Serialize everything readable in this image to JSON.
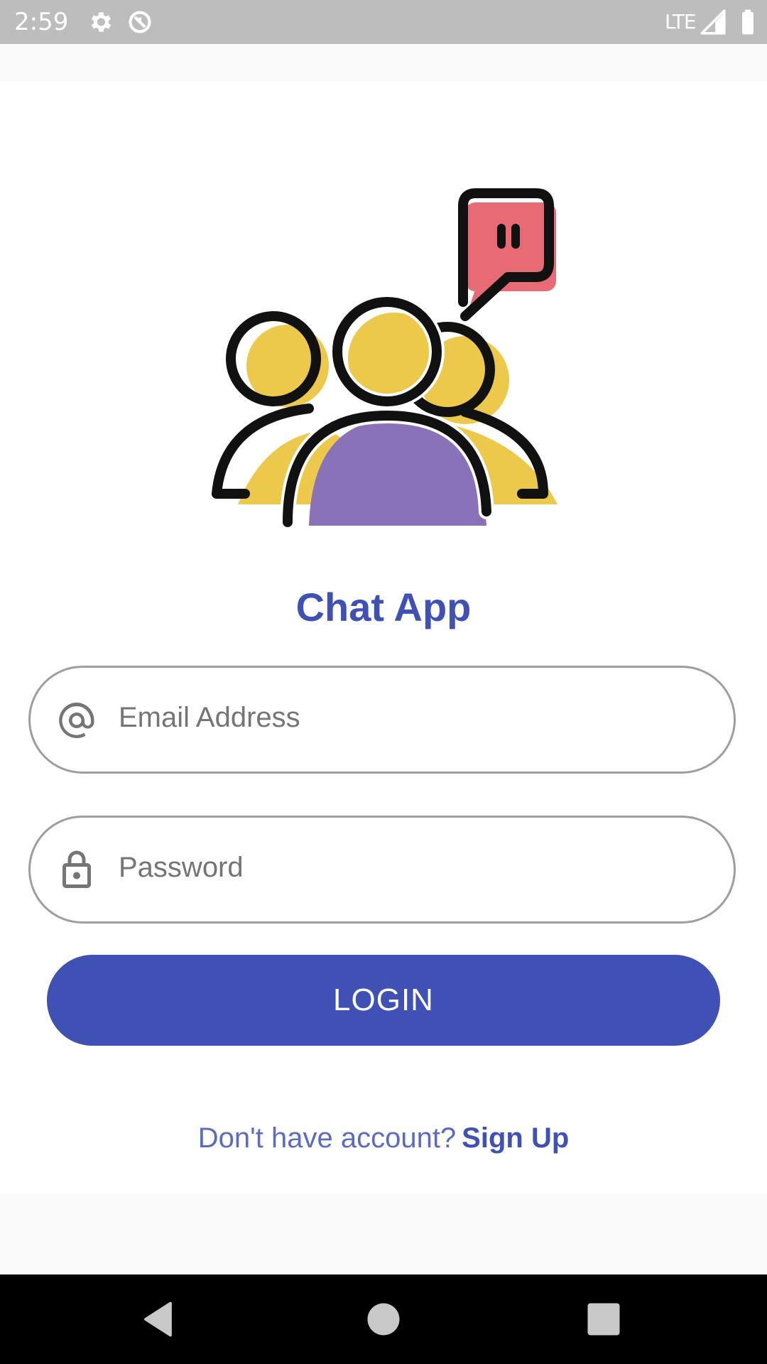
{
  "status_bar": {
    "time": "2:59",
    "network": "LTE",
    "icons": [
      "settings-icon",
      "sync-icon",
      "signal-icon",
      "battery-icon"
    ]
  },
  "app": {
    "title": "Chat App",
    "logo": "group-chat-logo"
  },
  "form": {
    "email": {
      "placeholder": "Email Address",
      "value": "",
      "icon": "at-sign-icon"
    },
    "password": {
      "placeholder": "Password",
      "value": "",
      "icon": "lock-icon"
    },
    "login_label": "LOGIN"
  },
  "footer": {
    "prompt": "Don't have account?",
    "signup_label": "Sign Up"
  },
  "nav_bar": {
    "buttons": [
      "back-icon",
      "home-icon",
      "recents-icon"
    ]
  },
  "colors": {
    "primary": "#3f51b5",
    "status_bar": "#bdbdbd",
    "nav_bar": "#000000",
    "logo_yellow": "#ecc94b",
    "logo_purple": "#8a72b8",
    "logo_pink": "#e86a75"
  }
}
